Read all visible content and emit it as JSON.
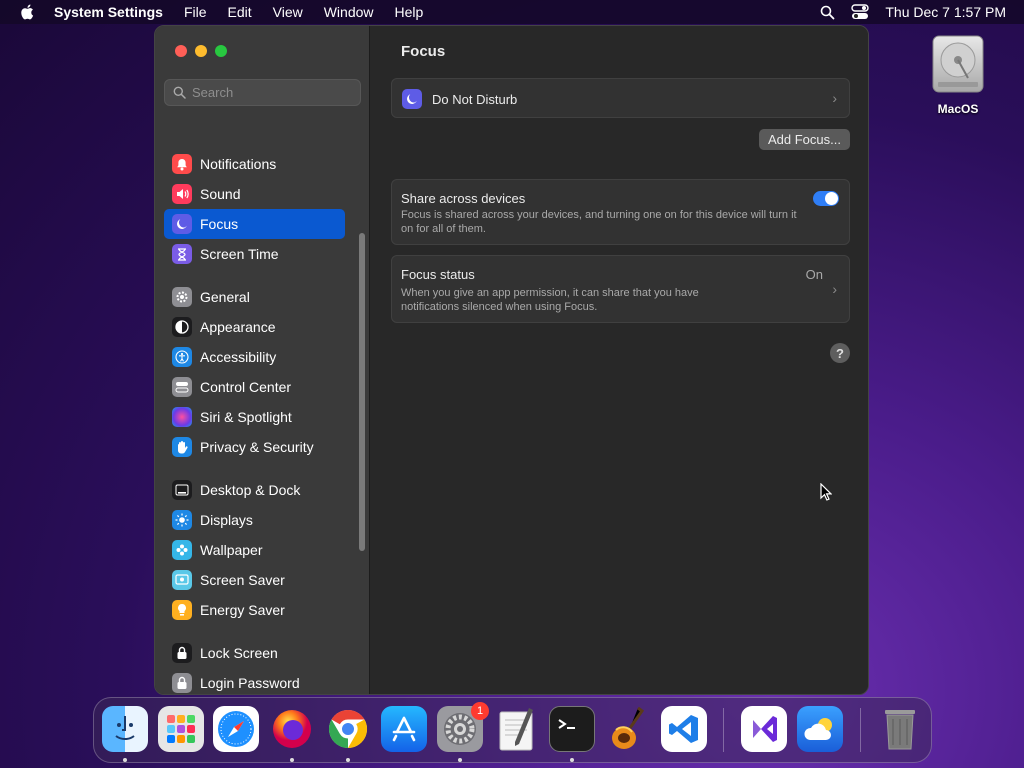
{
  "menubar": {
    "app_name": "System Settings",
    "menus": [
      "File",
      "Edit",
      "View",
      "Window",
      "Help"
    ],
    "clock": "Thu Dec 7  1:57 PM"
  },
  "desktop": {
    "disk_label": "MacOS"
  },
  "sidebar": {
    "search_placeholder": "Search",
    "items": [
      {
        "label": "Notifications",
        "icon": "bell-icon",
        "color": "#ff4b4b"
      },
      {
        "label": "Sound",
        "icon": "speaker-icon",
        "color": "#ff3b5c"
      },
      {
        "label": "Focus",
        "icon": "moon-icon",
        "color": "#5e5ce6",
        "active": true
      },
      {
        "label": "Screen Time",
        "icon": "hourglass-icon",
        "color": "#7a5ce6"
      },
      {
        "label": "General",
        "icon": "gear-icon",
        "color": "#8e8e93"
      },
      {
        "label": "Appearance",
        "icon": "appearance-icon",
        "color": "#1c1c1e"
      },
      {
        "label": "Accessibility",
        "icon": "accessibility-icon",
        "color": "#1e88e5"
      },
      {
        "label": "Control Center",
        "icon": "control-center-icon",
        "color": "#8e8e93"
      },
      {
        "label": "Siri & Spotlight",
        "icon": "siri-icon",
        "color": "#b03ad8"
      },
      {
        "label": "Privacy & Security",
        "icon": "hand-icon",
        "color": "#1e88e5"
      },
      {
        "label": "Desktop & Dock",
        "icon": "dock-icon",
        "color": "#1c1c1e"
      },
      {
        "label": "Displays",
        "icon": "sun-icon",
        "color": "#1e88e5"
      },
      {
        "label": "Wallpaper",
        "icon": "flower-icon",
        "color": "#35b6e8"
      },
      {
        "label": "Screen Saver",
        "icon": "screen-saver-icon",
        "color": "#5ac8e8"
      },
      {
        "label": "Energy Saver",
        "icon": "bulb-icon",
        "color": "#ffb020"
      },
      {
        "label": "Lock Screen",
        "icon": "lock-icon",
        "color": "#1c1c1e"
      },
      {
        "label": "Login Password",
        "icon": "lock-key-icon",
        "color": "#8e8e93"
      }
    ]
  },
  "content": {
    "title": "Focus",
    "dnd_label": "Do Not Disturb",
    "add_focus_label": "Add Focus...",
    "share_title": "Share across devices",
    "share_desc": "Focus is shared across your devices, and turning one on for this device will turn it on for all of them.",
    "share_enabled": true,
    "status_title": "Focus status",
    "status_value": "On",
    "status_desc": "When you give an app permission, it can share that you have notifications silenced when using Focus.",
    "help_label": "?"
  },
  "dock": {
    "badge_count": "1",
    "apps": [
      {
        "name": "finder",
        "color": "#2a8cf0"
      },
      {
        "name": "launchpad",
        "color": "#d8d8d8"
      },
      {
        "name": "safari",
        "color": "#2a8cf0"
      },
      {
        "name": "firefox",
        "color": "#ff7a1a"
      },
      {
        "name": "chrome",
        "color": "#ffffff"
      },
      {
        "name": "app-store",
        "color": "#1e90ff"
      },
      {
        "name": "system-settings",
        "color": "#8e8e93"
      },
      {
        "name": "textedit",
        "color": "#f3f3f3"
      },
      {
        "name": "terminal",
        "color": "#1a1a1a"
      },
      {
        "name": "garageband",
        "color": "#3a2a1a"
      },
      {
        "name": "vscode",
        "color": "#ffffff"
      },
      {
        "name": "visual-studio",
        "color": "#ffffff"
      },
      {
        "name": "weather",
        "color": "#1e7ee8"
      },
      {
        "name": "trash",
        "color": "#6b6b6b"
      }
    ]
  }
}
